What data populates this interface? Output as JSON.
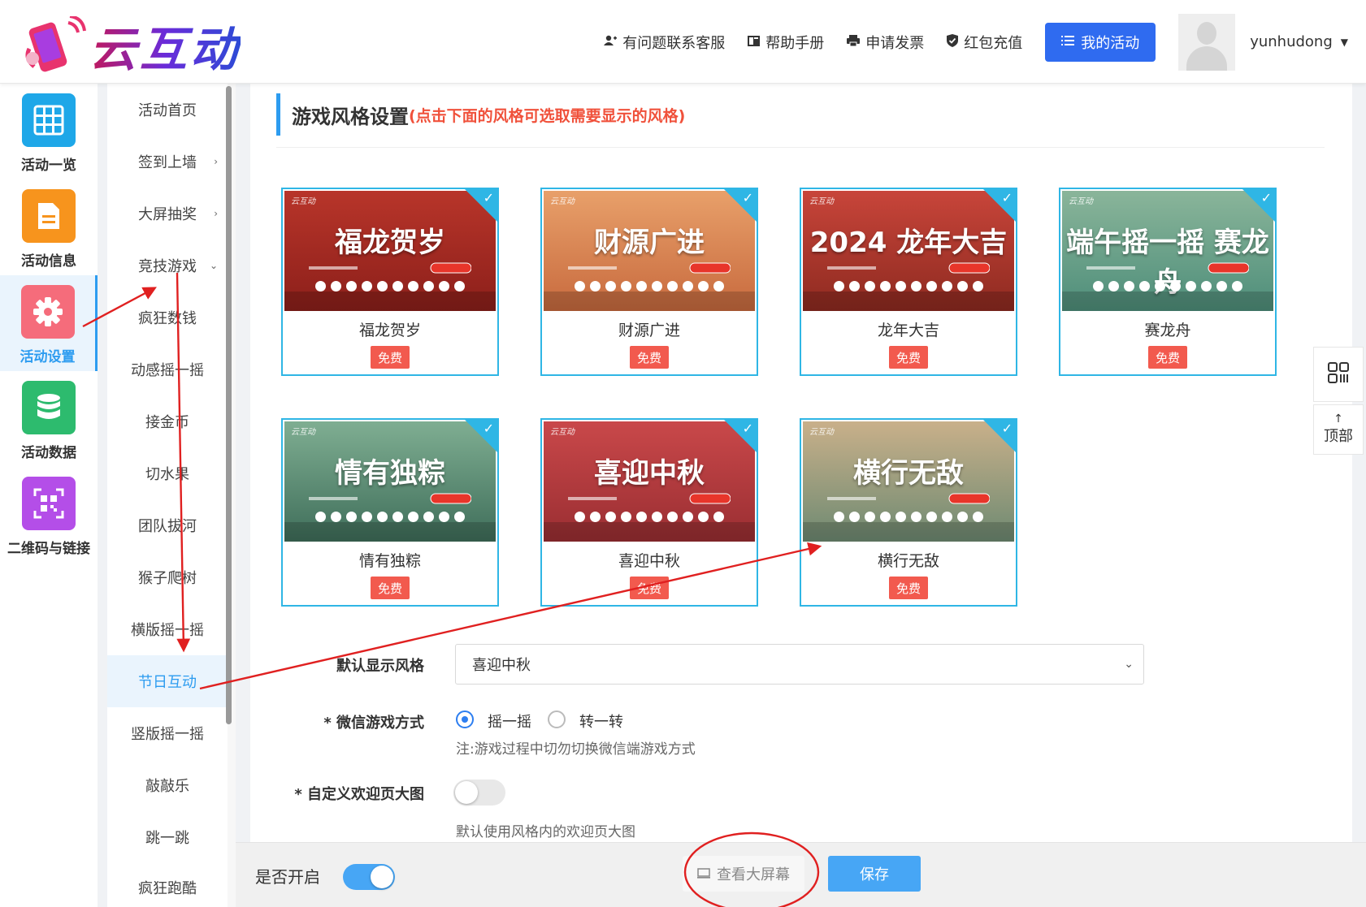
{
  "brand": {
    "logo_text": "云互动"
  },
  "header": {
    "nav": [
      {
        "label": "有问题联系客服",
        "icon": "user-plus-icon"
      },
      {
        "label": "帮助手册",
        "icon": "book-icon"
      },
      {
        "label": "申请发票",
        "icon": "printer-icon"
      },
      {
        "label": "红包充值",
        "icon": "shield-check-icon"
      }
    ],
    "my_activity": "我的活动",
    "username": "yunhudong"
  },
  "sidebar": {
    "items": [
      {
        "label": "活动一览",
        "icon": "grid-icon",
        "color": "#1ea7e8"
      },
      {
        "label": "活动信息",
        "icon": "document-icon",
        "color": "#f7941d"
      },
      {
        "label": "活动设置",
        "icon": "gear-icon",
        "color": "#f56c7b"
      },
      {
        "label": "活动数据",
        "icon": "database-icon",
        "color": "#2dbb6e"
      },
      {
        "label": "二维码与链接",
        "icon": "qrcode-icon",
        "color": "#b44ee8"
      }
    ]
  },
  "subnav": {
    "items": [
      {
        "label": "活动首页",
        "arrow": ""
      },
      {
        "label": "签到上墙",
        "arrow": "›"
      },
      {
        "label": "大屏抽奖",
        "arrow": "›"
      },
      {
        "label": "竞技游戏",
        "arrow": "⌄"
      },
      {
        "label": "疯狂数钱",
        "arrow": ""
      },
      {
        "label": "动感摇一摇",
        "arrow": ""
      },
      {
        "label": "接金币",
        "arrow": ""
      },
      {
        "label": "切水果",
        "arrow": ""
      },
      {
        "label": "团队拔河",
        "arrow": ""
      },
      {
        "label": "猴子爬树",
        "arrow": ""
      },
      {
        "label": "横版摇一摇",
        "arrow": ""
      },
      {
        "label": "节日互动",
        "arrow": ""
      },
      {
        "label": "竖版摇一摇",
        "arrow": ""
      },
      {
        "label": "敲敲乐",
        "arrow": ""
      },
      {
        "label": "跳一跳",
        "arrow": ""
      },
      {
        "label": "疯狂跑酷",
        "arrow": ""
      }
    ]
  },
  "section": {
    "title": "游戏风格设置",
    "hint": "(点击下面的风格可选取需要显示的风格)"
  },
  "styles": [
    {
      "name": "福龙贺岁",
      "badge": "免费",
      "art": "福龙贺岁",
      "bg": "#b8352a",
      "bg2": "#8c1f1a",
      "brand": "云互动"
    },
    {
      "name": "财源广进",
      "badge": "免费",
      "art": "财源广进",
      "bg": "#e8a06a",
      "bg2": "#c86a3e",
      "brand": "云互动"
    },
    {
      "name": "龙年大吉",
      "badge": "免费",
      "art": "2024 龙年大吉",
      "bg": "#c8453a",
      "bg2": "#8e2a20",
      "brand": "云互动"
    },
    {
      "name": "赛龙舟",
      "badge": "免费",
      "art": "端午摇一摇 赛龙舟",
      "bg": "#8ab59a",
      "bg2": "#4e8e7a",
      "brand": "云互动"
    },
    {
      "name": "情有独粽",
      "badge": "免费",
      "art": "情有独粽",
      "bg": "#7fae92",
      "bg2": "#3f6e5a",
      "brand": "云互动"
    },
    {
      "name": "喜迎中秋",
      "badge": "免费",
      "art": "喜迎中秋",
      "bg": "#c9484a",
      "bg2": "#9a2e32",
      "brand": "云互动"
    },
    {
      "name": "横行无敌",
      "badge": "免费",
      "art": "横行无敌",
      "bg": "#c9b08a",
      "bg2": "#6e8a72",
      "brand": "云互动"
    }
  ],
  "form": {
    "default_style_label": "默认显示风格",
    "default_style_value": "喜迎中秋",
    "game_mode_label": "* 微信游戏方式",
    "game_mode_options": [
      "摇一摇",
      "转一转"
    ],
    "game_mode_selected": "摇一摇",
    "game_mode_note": "注:游戏过程中切勿切换微信端游戏方式",
    "custom_welcome_label": "* 自定义欢迎页大图",
    "custom_welcome_on": false,
    "custom_welcome_note": "默认使用风格内的欢迎页大图"
  },
  "bottom": {
    "enable_label": "是否开启",
    "enable_on": true,
    "view_screen": "查看大屏幕",
    "save": "保存"
  },
  "float_tools": {
    "top_label": "顶部"
  },
  "colors": {
    "accent": "#2d9cf0",
    "primary_button": "#2f6bf0",
    "badge": "#f25a4e",
    "card_border": "#2fb6e5",
    "annotation": "#e02020"
  }
}
